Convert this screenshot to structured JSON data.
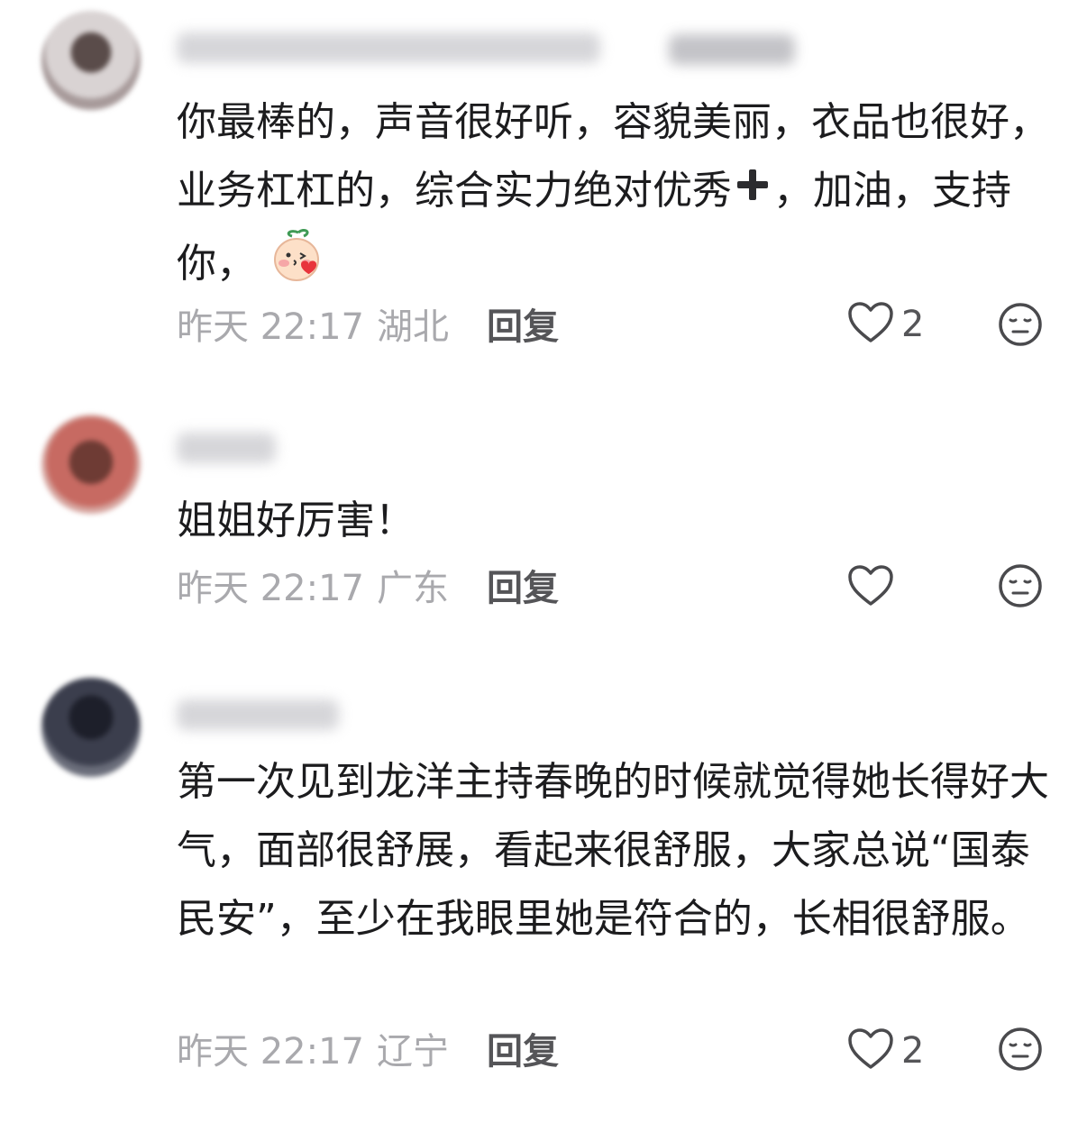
{
  "comments": [
    {
      "text_before_plus": "你最棒的，声音很好听，容貌美丽，衣品也很好，业务杠杠的，综合实力绝对优秀",
      "text_after_plus": "，加油，支持你，",
      "time": "昨天 22:17",
      "location": "湖北",
      "reply_label": "回复",
      "like_count": "2",
      "emoji": "blushing-blowing-kiss-sticker",
      "plus_icon": "heavy-plus-icon"
    },
    {
      "text": "姐姐好厉害！",
      "time": "昨天 22:17",
      "location": "广东",
      "reply_label": "回复",
      "like_count": ""
    },
    {
      "text": "第一次见到龙洋主持春晚的时候就觉得她长得好大气，面部很舒展，看起来很舒服，大家总说“国泰民安”，至少在我眼里她是符合的，长相很舒服。",
      "time": "昨天 22:17",
      "location": "辽宁",
      "reply_label": "回复",
      "like_count": "2"
    }
  ],
  "icons": {
    "like": "heart-outline-icon",
    "dislike": "expressionless-face-icon"
  },
  "colors": {
    "text": "#1c1c1e",
    "meta": "#a9a9ad",
    "action": "#555558"
  }
}
